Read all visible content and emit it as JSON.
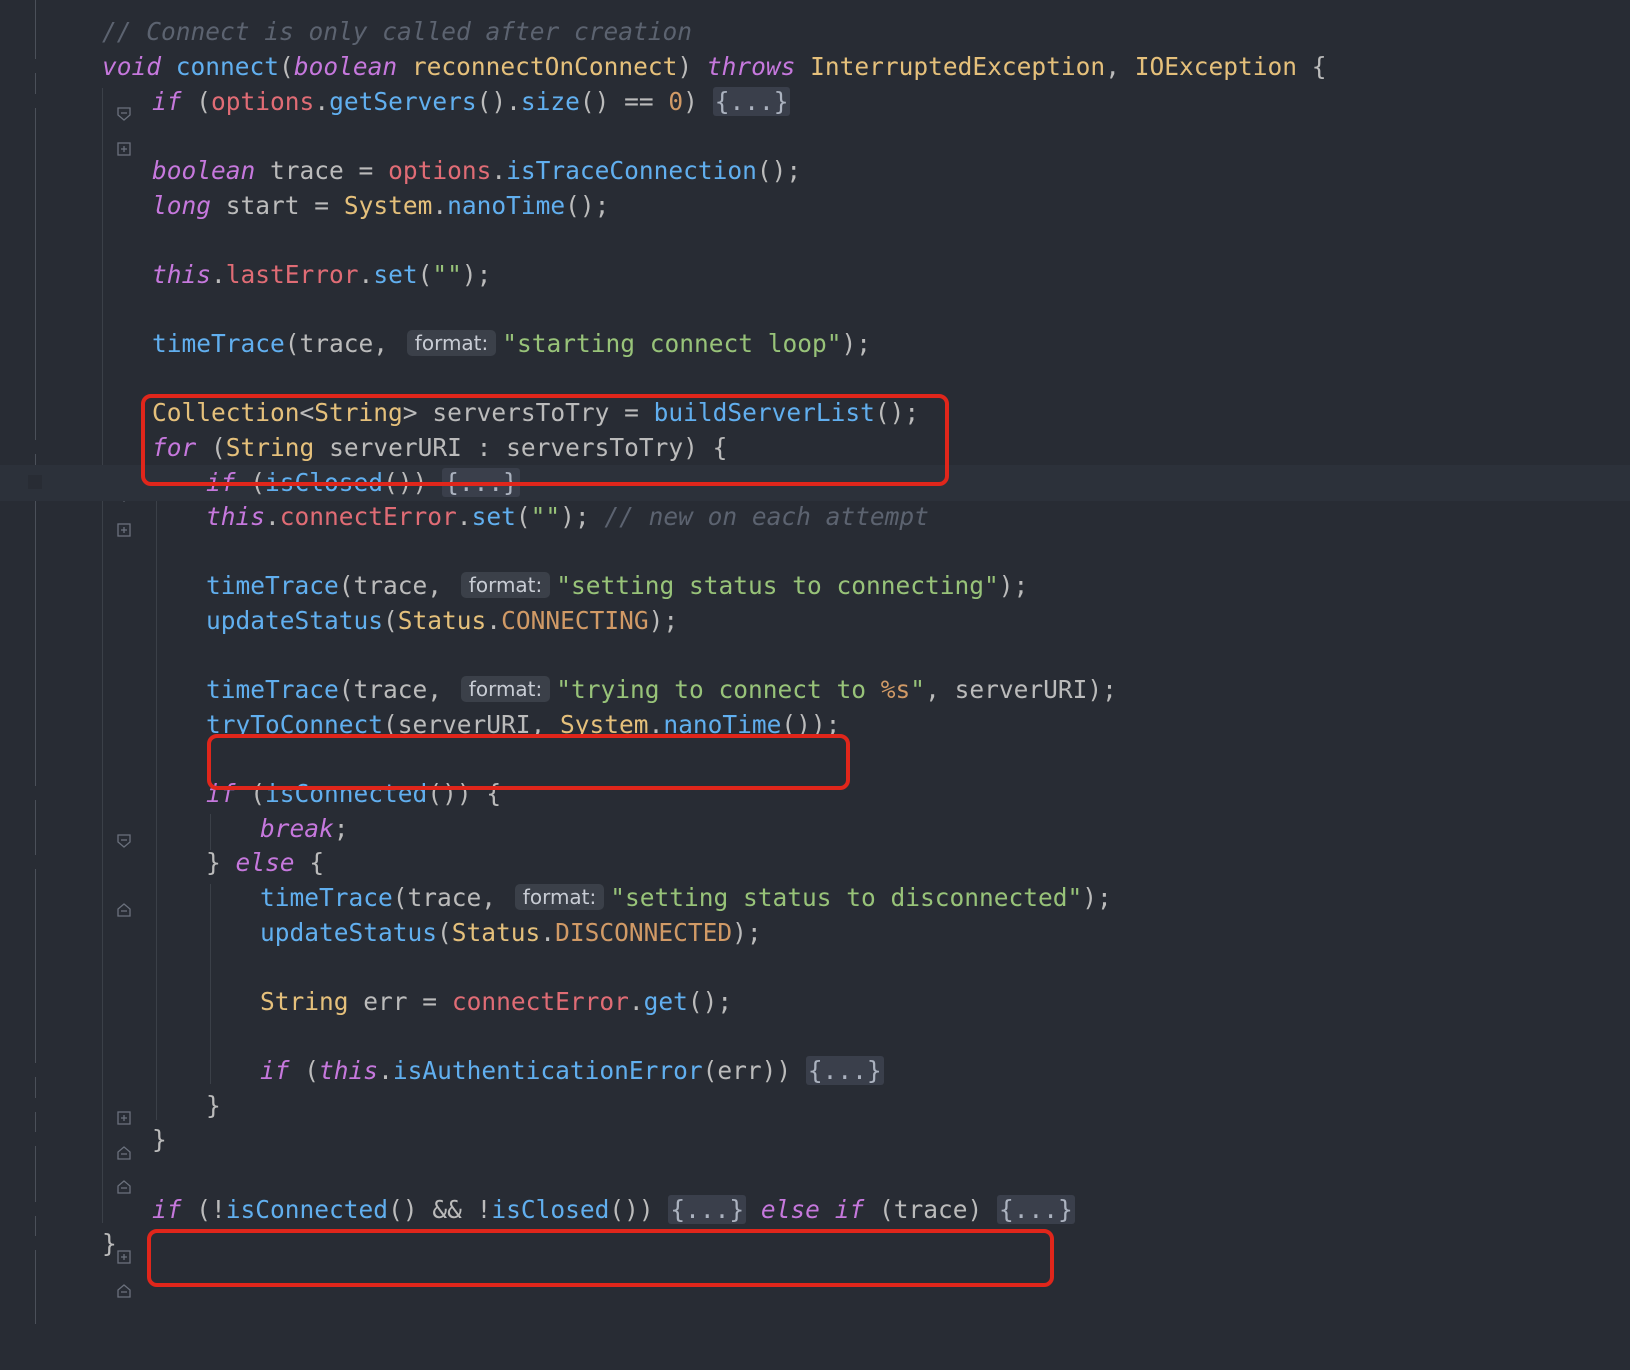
{
  "editor": {
    "comment_header": "// Connect is only called after creation",
    "sig": {
      "ret": "void",
      "name": "connect",
      "lp": "(",
      "ptype": "boolean",
      "pname": "reconnectOnConnect",
      "rp": ")",
      "throws": "throws",
      "ex1": "InterruptedException",
      "comma": ",",
      "ex2": "IOException",
      "brace": "{"
    },
    "l_servers": {
      "if": "if",
      "lp": "(",
      "obj": "options",
      "dot1": ".",
      "m1": "getServers",
      "par1": "().",
      "m2": "size",
      "op": "() ==",
      "zero": "0",
      "rp": ")",
      "folded": "{...}"
    },
    "l_trace": {
      "type": "boolean",
      "var": "trace =",
      "obj": "options",
      "dot": ".",
      "m": "isTraceConnection",
      "end": "();"
    },
    "l_start": {
      "type": "long",
      "var": "start =",
      "cls": "System",
      "dot": ".",
      "m": "nanoTime",
      "end": "();"
    },
    "l_lasterr": {
      "this": "this",
      "dot1": ".",
      "f": "lastError",
      "dot2": ".",
      "m": "set",
      "lp": "(",
      "s": "\"\"",
      "end": ");"
    },
    "l_tt1": {
      "fn": "timeTrace",
      "args": "(trace,",
      "hint": "format:",
      "s": "\"starting connect loop\"",
      "end": ");"
    },
    "l_coll": {
      "type": "Collection",
      "lt": "<",
      "type2": "String",
      "gt": ">",
      "var": "serversToTry =",
      "fn": "buildServerList",
      "end": "();"
    },
    "l_for": {
      "for": "for",
      "lp": "(",
      "type": "String",
      "rest": "serverURI : serversToTry) {"
    },
    "l_ifclosed": {
      "if": "if",
      "lp": "(",
      "fn": "isClosed",
      "rp": "())",
      "folded": "{...}"
    },
    "l_connerr": {
      "this": "this",
      "dot1": ".",
      "f": "connectError",
      "dot2": ".",
      "m": "set",
      "lp": "(",
      "s": "\"\"",
      "end": ");",
      "cmt": "// new on each attempt"
    },
    "l_tt2": {
      "fn": "timeTrace",
      "args": "(trace,",
      "hint": "format:",
      "s": "\"setting status to connecting\"",
      "end": ");"
    },
    "l_us1": {
      "fn": "updateStatus",
      "lp": "(",
      "cls": "Status",
      "dot": ".",
      "c": "CONNECTING",
      "end": ");"
    },
    "l_tt3": {
      "fn": "timeTrace",
      "args": "(trace,",
      "hint": "format:",
      "s1": "\"trying to connect to ",
      "fmt": "%s",
      "s2": "\"",
      "end": ", serverURI);"
    },
    "l_try": {
      "fn": "tryToConnect",
      "args": "(serverURI,",
      "cls": "System",
      "dot": ".",
      "m": "nanoTime",
      "end": "());"
    },
    "l_ifconn": {
      "if": "if",
      "lp": "(",
      "fn": "isConnected",
      "rest": "()) {"
    },
    "l_break": {
      "kw": "break",
      "end": ";"
    },
    "l_else": {
      "rb": "}",
      "kw": "else",
      "lb": "{"
    },
    "l_tt4": {
      "fn": "timeTrace",
      "args": "(trace,",
      "hint": "format:",
      "s": "\"setting status to disconnected\"",
      "end": ");"
    },
    "l_us2": {
      "fn": "updateStatus",
      "lp": "(",
      "cls": "Status",
      "dot": ".",
      "c": "DISCONNECTED",
      "end": ");"
    },
    "l_err": {
      "type": "String",
      "var": "err =",
      "f": "connectError",
      "dot": ".",
      "m": "get",
      "end": "();"
    },
    "l_ifauth": {
      "if": "if",
      "lp": "(",
      "this": "this",
      "dot": ".",
      "fn": "isAuthenticationError",
      "rest": "(err))",
      "folded": "{...}"
    },
    "close1": "}",
    "close2": "}",
    "l_final": {
      "if": "if",
      "p1": "(!",
      "fn1": "isConnected",
      "p2": "() && !",
      "fn2": "isClosed",
      "p3": "())",
      "f1": "{...}",
      "else": "else",
      "if2": "if",
      "p4": "(trace)",
      "f2": "{...}"
    },
    "close3": "}"
  }
}
